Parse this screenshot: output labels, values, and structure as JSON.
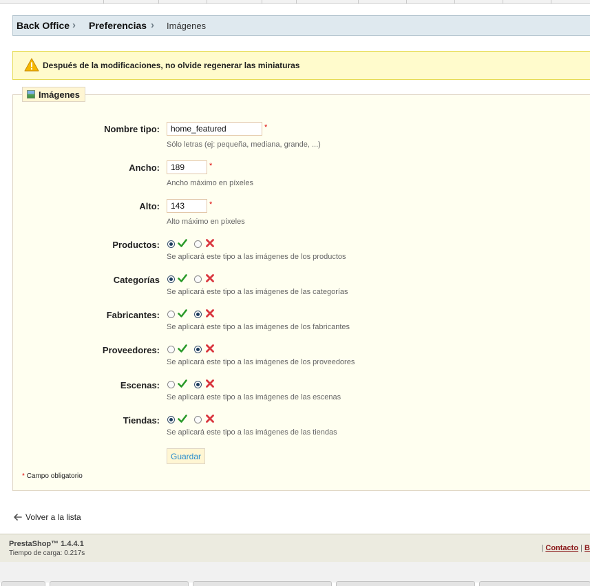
{
  "breadcrumb": {
    "items": [
      "Back Office",
      "Preferencias"
    ],
    "current": "Imágenes"
  },
  "warning": {
    "icon": "warning-icon",
    "text": "Después de la modificaciones, no olvide regenerar las miniaturas"
  },
  "form": {
    "legend": "Imágenes",
    "legend_icon": "image-icon",
    "fields": {
      "name": {
        "label": "Nombre tipo:",
        "value": "home_featured",
        "hint": "Sólo letras (ej: pequeña, mediana, grande, ...)",
        "required": "*"
      },
      "width": {
        "label": "Ancho:",
        "value": "189",
        "hint": "Ancho máximo en píxeles",
        "required": "*"
      },
      "height": {
        "label": "Alto:",
        "value": "143",
        "hint": "Alto máximo en píxeles",
        "required": "*"
      }
    },
    "toggles": [
      {
        "label": "Productos:",
        "value": "yes",
        "hint": "Se aplicará este tipo a las imágenes de los productos"
      },
      {
        "label": "Categorías",
        "value": "yes",
        "hint": "Se aplicará este tipo a las imágenes de las categorías"
      },
      {
        "label": "Fabricantes:",
        "value": "no",
        "hint": "Se aplicará este tipo a las imágenes de los fabricantes"
      },
      {
        "label": "Proveedores:",
        "value": "no",
        "hint": "Se aplicará este tipo a las imágenes de los proveedores"
      },
      {
        "label": "Escenas:",
        "value": "no",
        "hint": "Se aplicará este tipo a las imágenes de las escenas"
      },
      {
        "label": "Tiendas:",
        "value": "yes",
        "hint": "Se aplicará este tipo a las imágenes de las tiendas"
      }
    ],
    "save_label": "Guardar",
    "required_star": "*",
    "required_note": "Campo obligatorio"
  },
  "back_link": "Volver a la lista",
  "footer": {
    "version": "PrestaShop™ 1.4.4.1",
    "load_time": "Tiempo de carga: 0.217s",
    "sep": "|",
    "contact": "Contacto",
    "cut_link": "B"
  },
  "colors": {
    "breadcrumb_bg": "#dfe9ef",
    "warning_bg": "#fffbcc",
    "fieldset_bg": "#fffff0",
    "check_green": "#2a9a2a",
    "cross_red": "#d9363e",
    "button_text": "#268ccd"
  }
}
